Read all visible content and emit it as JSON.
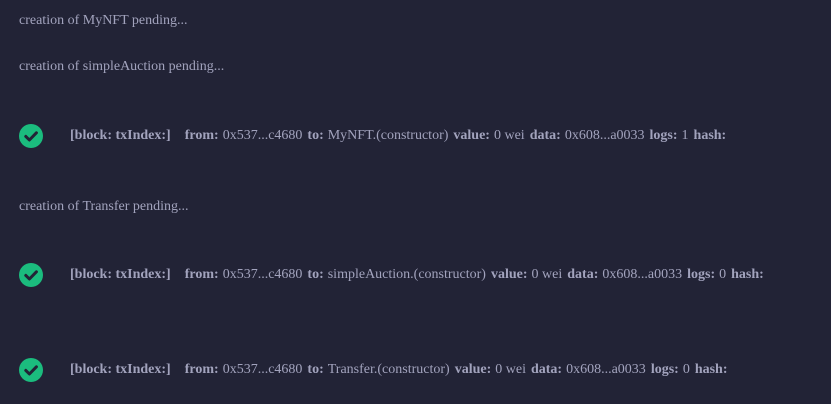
{
  "messages": {
    "pending_mynft": "creation of MyNFT pending...",
    "pending_simpleauction": "creation of simpleAuction pending...",
    "pending_transfer": "creation of Transfer pending..."
  },
  "labels": {
    "block": "[block: txIndex:]",
    "from": "from:",
    "to": "to:",
    "value": "value:",
    "data": "data:",
    "logs": "logs:",
    "hash": "hash:"
  },
  "transactions": [
    {
      "status_icon": "check-circle-icon",
      "from": "0x537...c4680",
      "to": "MyNFT.(constructor)",
      "value": "0 wei",
      "data": "0x608...a0033",
      "logs": "1"
    },
    {
      "status_icon": "check-circle-icon",
      "from": "0x537...c4680",
      "to": "simpleAuction.(constructor)",
      "value": "0 wei",
      "data": "0x608...a0033",
      "logs": "0"
    },
    {
      "status_icon": "check-circle-icon",
      "from": "0x537...c4680",
      "to": "Transfer.(constructor)",
      "value": "0 wei",
      "data": "0x608...a0033",
      "logs": "0"
    }
  ],
  "colors": {
    "background": "#222336",
    "text": "#a2a3bd",
    "success": "#1bbc7e"
  }
}
